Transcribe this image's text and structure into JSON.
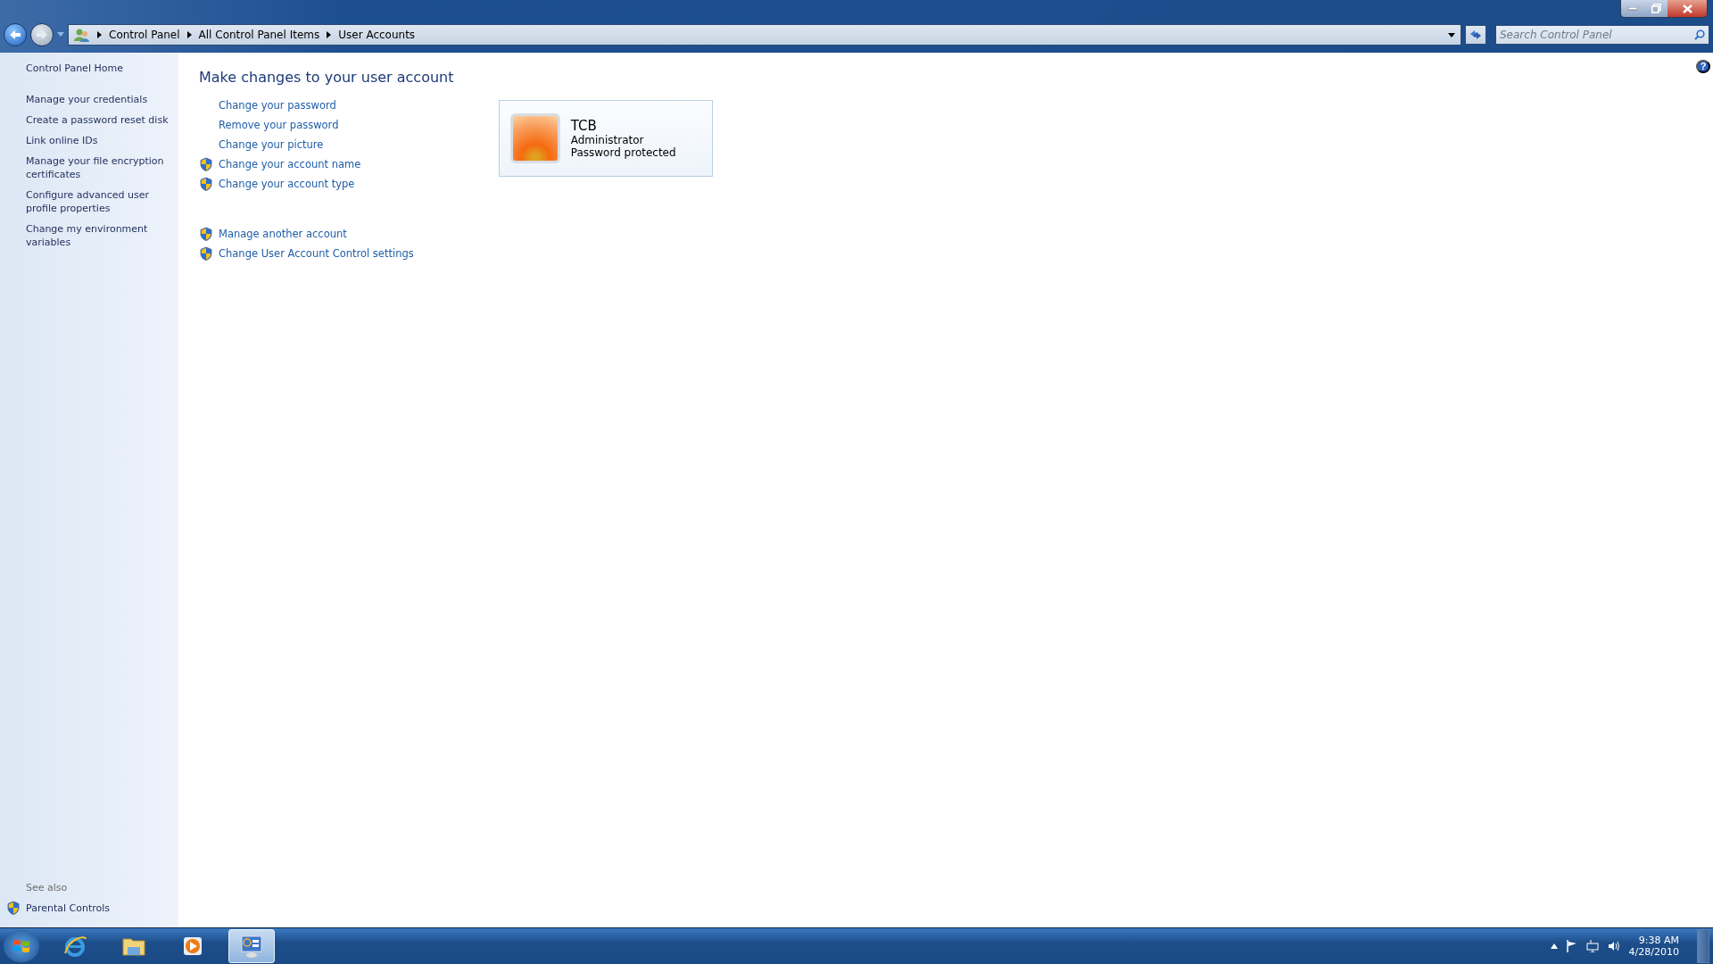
{
  "address_bar": {
    "breadcrumbs": [
      "Control Panel",
      "All Control Panel Items",
      "User Accounts"
    ]
  },
  "search": {
    "placeholder": "Search Control Panel"
  },
  "sidebar": {
    "items": [
      {
        "label": "Control Panel Home",
        "kind": "home"
      },
      {
        "label": "Manage your credentials",
        "kind": "link"
      },
      {
        "label": "Create a password reset disk",
        "kind": "link"
      },
      {
        "label": "Link online IDs",
        "kind": "link"
      },
      {
        "label": "Manage your file encryption certificates",
        "kind": "link"
      },
      {
        "label": "Configure advanced user profile properties",
        "kind": "link"
      },
      {
        "label": "Change my environment variables",
        "kind": "link"
      }
    ],
    "see_also": {
      "heading": "See also",
      "items": [
        {
          "label": "Parental Controls",
          "shield": true
        }
      ]
    }
  },
  "main": {
    "help": "?",
    "heading": "Make changes to your user account",
    "task_groups": [
      [
        {
          "label": "Change your password",
          "shield": false
        },
        {
          "label": "Remove your password",
          "shield": false
        },
        {
          "label": "Change your picture",
          "shield": false
        },
        {
          "label": "Change your account name",
          "shield": true
        },
        {
          "label": "Change your account type",
          "shield": true
        }
      ],
      [
        {
          "label": "Manage another account",
          "shield": true
        },
        {
          "label": "Change User Account Control settings",
          "shield": true
        }
      ]
    ],
    "account": {
      "name": "TCB",
      "type": "Administrator",
      "status": "Password protected"
    }
  },
  "taskbar": {
    "apps": [
      {
        "kind": "ie",
        "selected": false
      },
      {
        "kind": "explorer",
        "selected": false
      },
      {
        "kind": "media",
        "selected": false
      },
      {
        "kind": "control",
        "selected": true
      }
    ],
    "time": "9:38 AM",
    "date": "4/28/2010"
  }
}
